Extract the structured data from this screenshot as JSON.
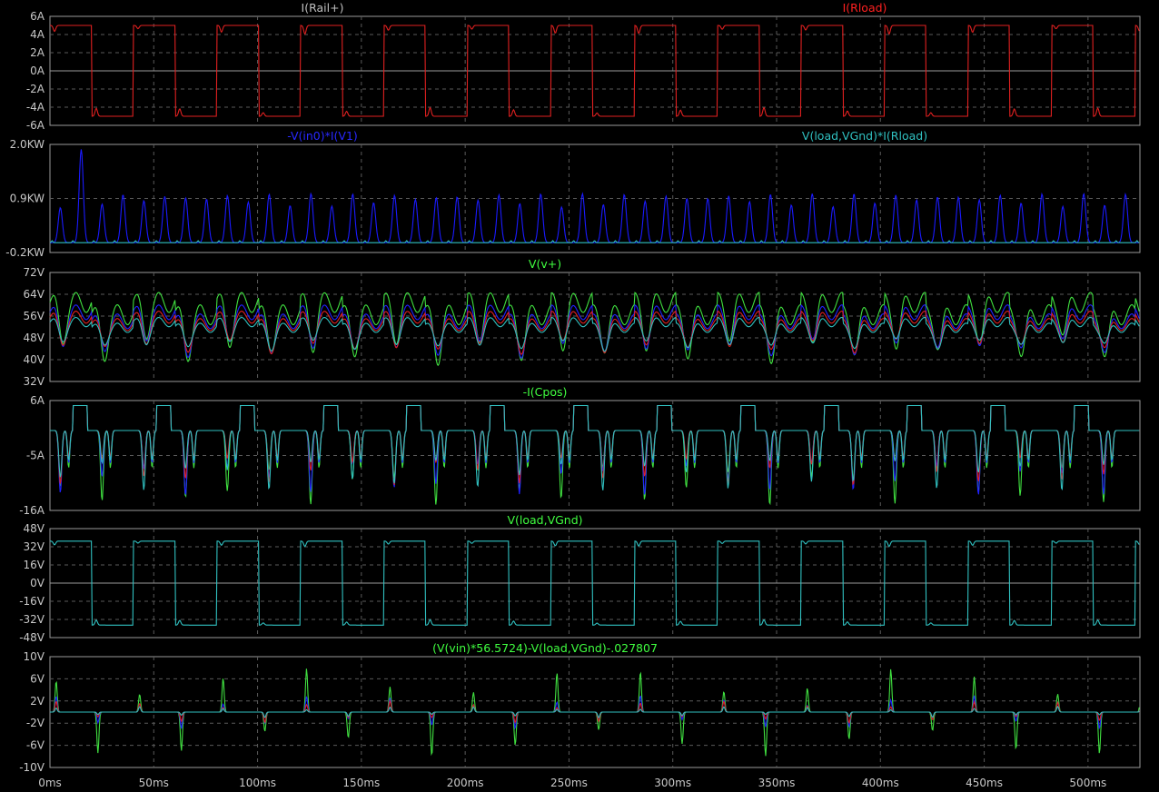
{
  "chart_data": [
    {
      "type": "line",
      "title_left": "I(Rail+)",
      "title_left_color": "#bfbfbf",
      "title_right": "I(Rload)",
      "title_right_color": "#ff2020",
      "ylim": [
        -6,
        6
      ],
      "yticks": [
        "6A",
        "4A",
        "2A",
        "0A",
        "-2A",
        "-4A",
        "-6A"
      ],
      "series": [
        {
          "color": "#e02020",
          "shape": "square",
          "high": 5,
          "low": -5,
          "overshoot": 0.6
        }
      ]
    },
    {
      "type": "line",
      "title_left": "-V(in0)*I(V1)",
      "title_left_color": "#2828ff",
      "title_right": "V(load,VGnd)*I(Rload)",
      "title_right_color": "#30c0c0",
      "ylim": [
        -0.2,
        2.0
      ],
      "yticks": [
        "2.0KW",
        "0.9KW",
        "-0.2KW"
      ],
      "series": [
        {
          "color": "#1a1aff",
          "shape": "spikes",
          "base": 0.0,
          "peak": 0.95,
          "first_peak": 1.9
        },
        {
          "color": "#30c0c0",
          "shape": "flat",
          "base": 0.0
        }
      ]
    },
    {
      "type": "line",
      "title": "V(v+)",
      "title_color": "#40ff40",
      "ylim": [
        32,
        72
      ],
      "yticks": [
        "72V",
        "64V",
        "56V",
        "48V",
        "40V",
        "32V"
      ],
      "series": [
        {
          "color": "#40e040",
          "shape": "ripple",
          "mid": 55,
          "amp": 15
        },
        {
          "color": "#2020ff",
          "shape": "ripple",
          "mid": 53,
          "amp": 11
        },
        {
          "color": "#e02020",
          "shape": "ripple",
          "mid": 52,
          "amp": 9
        },
        {
          "color": "#30c0c0",
          "shape": "ripple",
          "mid": 51,
          "amp": 7
        }
      ]
    },
    {
      "type": "line",
      "title": "-I(Cpos)",
      "title_color": "#40ff40",
      "ylim": [
        -16,
        6
      ],
      "yticks": [
        "6A",
        "-5A",
        "-16A"
      ],
      "series": [
        {
          "color": "#40e040",
          "shape": "dips",
          "base": 0,
          "depth": -15
        },
        {
          "color": "#2020ff",
          "shape": "dips",
          "base": 0,
          "depth": -13
        },
        {
          "color": "#e02020",
          "shape": "dips",
          "base": 0,
          "depth": -11
        },
        {
          "color": "#30c0c0",
          "shape": "dips",
          "base": 0,
          "depth": -12
        }
      ]
    },
    {
      "type": "line",
      "title": "V(load,VGnd)",
      "title_color": "#40ff40",
      "ylim": [
        -48,
        48
      ],
      "yticks": [
        "48V",
        "32V",
        "16V",
        "0V",
        "-16V",
        "-32V",
        "-48V"
      ],
      "series": [
        {
          "color": "#30c0c0",
          "shape": "square",
          "high": 37,
          "low": -37,
          "overshoot": 3
        }
      ]
    },
    {
      "type": "line",
      "title": "(V(vin)*56.5724)-V(load,VGnd)-.027807",
      "title_color": "#40ff40",
      "ylim": [
        -10,
        10
      ],
      "yticks": [
        "10V",
        "6V",
        "2V",
        "-2V",
        "-6V",
        "-10V"
      ],
      "series": [
        {
          "color": "#40e040",
          "shape": "edge-spikes",
          "base": 0,
          "amp": 8
        },
        {
          "color": "#2020ff",
          "shape": "edge-spikes",
          "base": 0,
          "amp": 3
        },
        {
          "color": "#e02020",
          "shape": "edge-spikes",
          "base": 0,
          "amp": 2
        },
        {
          "color": "#30c0c0",
          "shape": "edge-spikes",
          "base": 0,
          "amp": 1
        }
      ]
    }
  ],
  "x_axis": {
    "xlim": [
      0,
      525
    ],
    "unit": "ms",
    "ticks": [
      "0ms",
      "50ms",
      "100ms",
      "150ms",
      "200ms",
      "250ms",
      "300ms",
      "350ms",
      "400ms",
      "450ms",
      "500ms"
    ]
  },
  "colors": {
    "background": "#000000",
    "frame": "#9a9a9a",
    "grid": "#5a5a5a",
    "tick_text": "#c8c8c8"
  }
}
